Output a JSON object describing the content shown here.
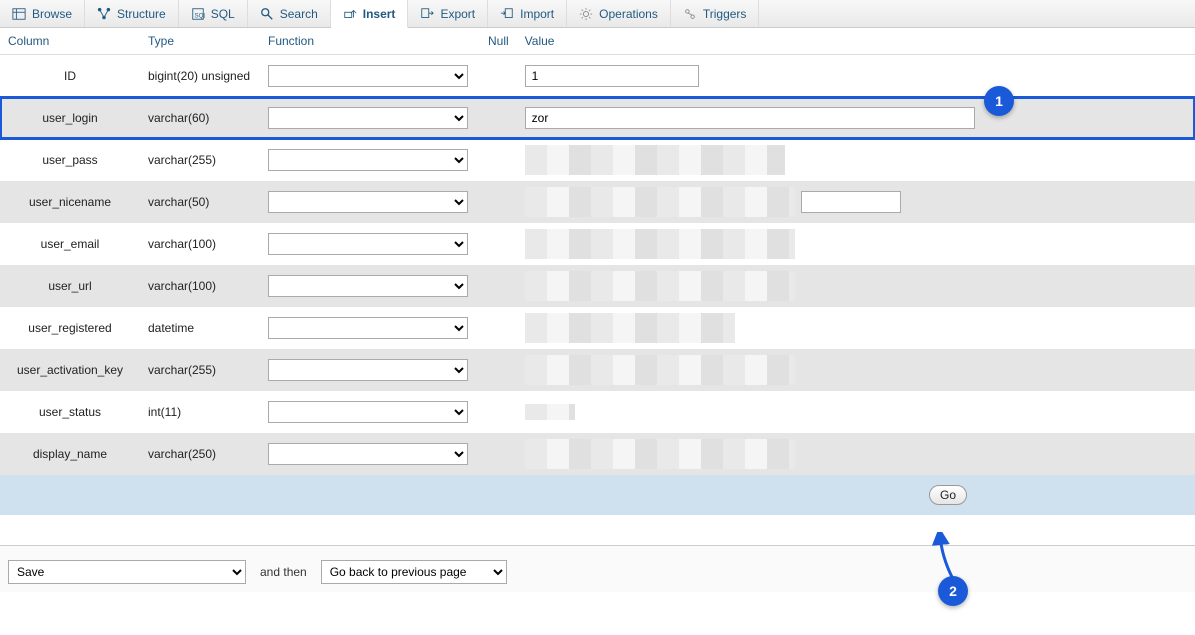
{
  "tabs": [
    {
      "label": "Browse"
    },
    {
      "label": "Structure"
    },
    {
      "label": "SQL"
    },
    {
      "label": "Search"
    },
    {
      "label": "Insert",
      "active": true
    },
    {
      "label": "Export"
    },
    {
      "label": "Import"
    },
    {
      "label": "Operations"
    },
    {
      "label": "Triggers"
    }
  ],
  "headers": {
    "column": "Column",
    "type": "Type",
    "function": "Function",
    "null": "Null",
    "value": "Value"
  },
  "rows": [
    {
      "name": "ID",
      "type": "bigint(20) unsigned",
      "value": "1",
      "input_class": "value-id"
    },
    {
      "name": "user_login",
      "type": "varchar(60)",
      "value": "zor",
      "input_class": "value-wide",
      "highlight": true
    },
    {
      "name": "user_pass",
      "type": "varchar(255)",
      "redact": "redact-260"
    },
    {
      "name": "user_nicename",
      "type": "varchar(50)",
      "redact": "redact-270",
      "trail_input": true
    },
    {
      "name": "user_email",
      "type": "varchar(100)",
      "redact": "redact-270"
    },
    {
      "name": "user_url",
      "type": "varchar(100)",
      "redact": "redact-270"
    },
    {
      "name": "user_registered",
      "type": "datetime",
      "redact": "redact-210"
    },
    {
      "name": "user_activation_key",
      "type": "varchar(255)",
      "redact": "redact-270"
    },
    {
      "name": "user_status",
      "type": "int(11)",
      "redact": "redact-60"
    },
    {
      "name": "display_name",
      "type": "varchar(250)",
      "redact": "redact-270"
    }
  ],
  "go_label": "Go",
  "bottom": {
    "save_option": "Save",
    "then_label": "and then",
    "then_option": "Go back to previous page"
  },
  "callouts": {
    "one": "1",
    "two": "2"
  }
}
